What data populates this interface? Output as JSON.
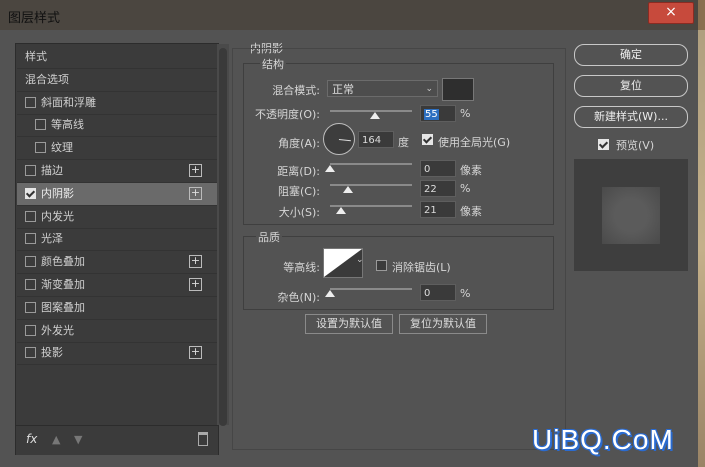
{
  "window": {
    "title": "图层样式",
    "close_icon": "×"
  },
  "left_panel": {
    "items": [
      {
        "label": "样式",
        "checkbox": false,
        "checked": false,
        "plus": false,
        "indent": 0,
        "selected": false
      },
      {
        "label": "混合选项",
        "checkbox": false,
        "checked": false,
        "plus": false,
        "indent": 0,
        "selected": false
      },
      {
        "label": "斜面和浮雕",
        "checkbox": true,
        "checked": false,
        "plus": false,
        "indent": 0,
        "selected": false
      },
      {
        "label": "等高线",
        "checkbox": true,
        "checked": false,
        "plus": false,
        "indent": 1,
        "selected": false
      },
      {
        "label": "纹理",
        "checkbox": true,
        "checked": false,
        "plus": false,
        "indent": 1,
        "selected": false
      },
      {
        "label": "描边",
        "checkbox": true,
        "checked": false,
        "plus": true,
        "indent": 0,
        "selected": false
      },
      {
        "label": "内阴影",
        "checkbox": true,
        "checked": true,
        "plus": true,
        "indent": 0,
        "selected": true
      },
      {
        "label": "内发光",
        "checkbox": true,
        "checked": false,
        "plus": false,
        "indent": 0,
        "selected": false
      },
      {
        "label": "光泽",
        "checkbox": true,
        "checked": false,
        "plus": false,
        "indent": 0,
        "selected": false
      },
      {
        "label": "颜色叠加",
        "checkbox": true,
        "checked": false,
        "plus": true,
        "indent": 0,
        "selected": false
      },
      {
        "label": "渐变叠加",
        "checkbox": true,
        "checked": false,
        "plus": true,
        "indent": 0,
        "selected": false
      },
      {
        "label": "图案叠加",
        "checkbox": true,
        "checked": false,
        "plus": false,
        "indent": 0,
        "selected": false
      },
      {
        "label": "外发光",
        "checkbox": true,
        "checked": false,
        "plus": false,
        "indent": 0,
        "selected": false
      },
      {
        "label": "投影",
        "checkbox": true,
        "checked": false,
        "plus": true,
        "indent": 0,
        "selected": false
      }
    ],
    "fx_label": "fx",
    "icons": {
      "fx": "fx-icon",
      "up": "arrow-up-icon",
      "down": "arrow-down-icon",
      "trash": "trash-icon"
    }
  },
  "inner_shadow": {
    "title": "内阴影",
    "structure": {
      "title": "结构",
      "blend_mode_label": "混合模式:",
      "blend_mode_value": "正常",
      "opacity_label": "不透明度(O):",
      "opacity_value": "55",
      "opacity_unit": "%",
      "opacity_fraction": 0.55,
      "angle_label": "角度(A):",
      "angle_value": "164",
      "angle_unit": "度",
      "global_light_label": "使用全局光(G)",
      "global_light_checked": true,
      "distance_label": "距离(D):",
      "distance_value": "0",
      "distance_unit": "像素",
      "distance_fraction": 0.0,
      "choke_label": "阻塞(C):",
      "choke_value": "22",
      "choke_unit": "%",
      "choke_fraction": 0.22,
      "size_label": "大小(S):",
      "size_value": "21",
      "size_unit": "像素",
      "size_fraction": 0.14
    },
    "quality": {
      "title": "品质",
      "contour_label": "等高线:",
      "antialias_label": "消除锯齿(L)",
      "antialias_checked": false,
      "noise_label": "杂色(N):",
      "noise_value": "0",
      "noise_unit": "%",
      "noise_fraction": 0.0
    },
    "make_default_label": "设置为默认值",
    "reset_default_label": "复位为默认值"
  },
  "right_panel": {
    "ok_label": "确定",
    "reset_label": "复位",
    "new_style_label": "新建样式(W)...",
    "preview_label": "预览(V)",
    "preview_checked": true
  },
  "watermark": "UiBQ.CoM"
}
